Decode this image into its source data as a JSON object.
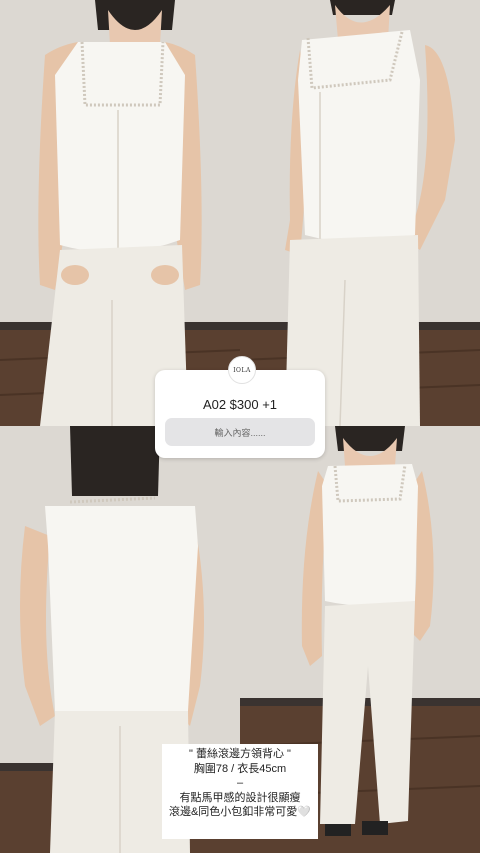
{
  "question_sticker": {
    "logo_text": "IOLA",
    "question": "A02 $300 +1",
    "input_placeholder": "輸入內容......"
  },
  "caption": {
    "lines": [
      "\" 蕾絲滾邊方領背心 \"",
      "胸圍78 / 衣長45cm",
      "–",
      "有點馬甲感的設計很顯瘦",
      "滾邊&同色小包釦非常可愛🤍"
    ]
  },
  "colors": {
    "wall": "#dcd8d2",
    "floor": "#5a4030",
    "garment": "#f7f6f2",
    "hair": "#2a2522"
  }
}
